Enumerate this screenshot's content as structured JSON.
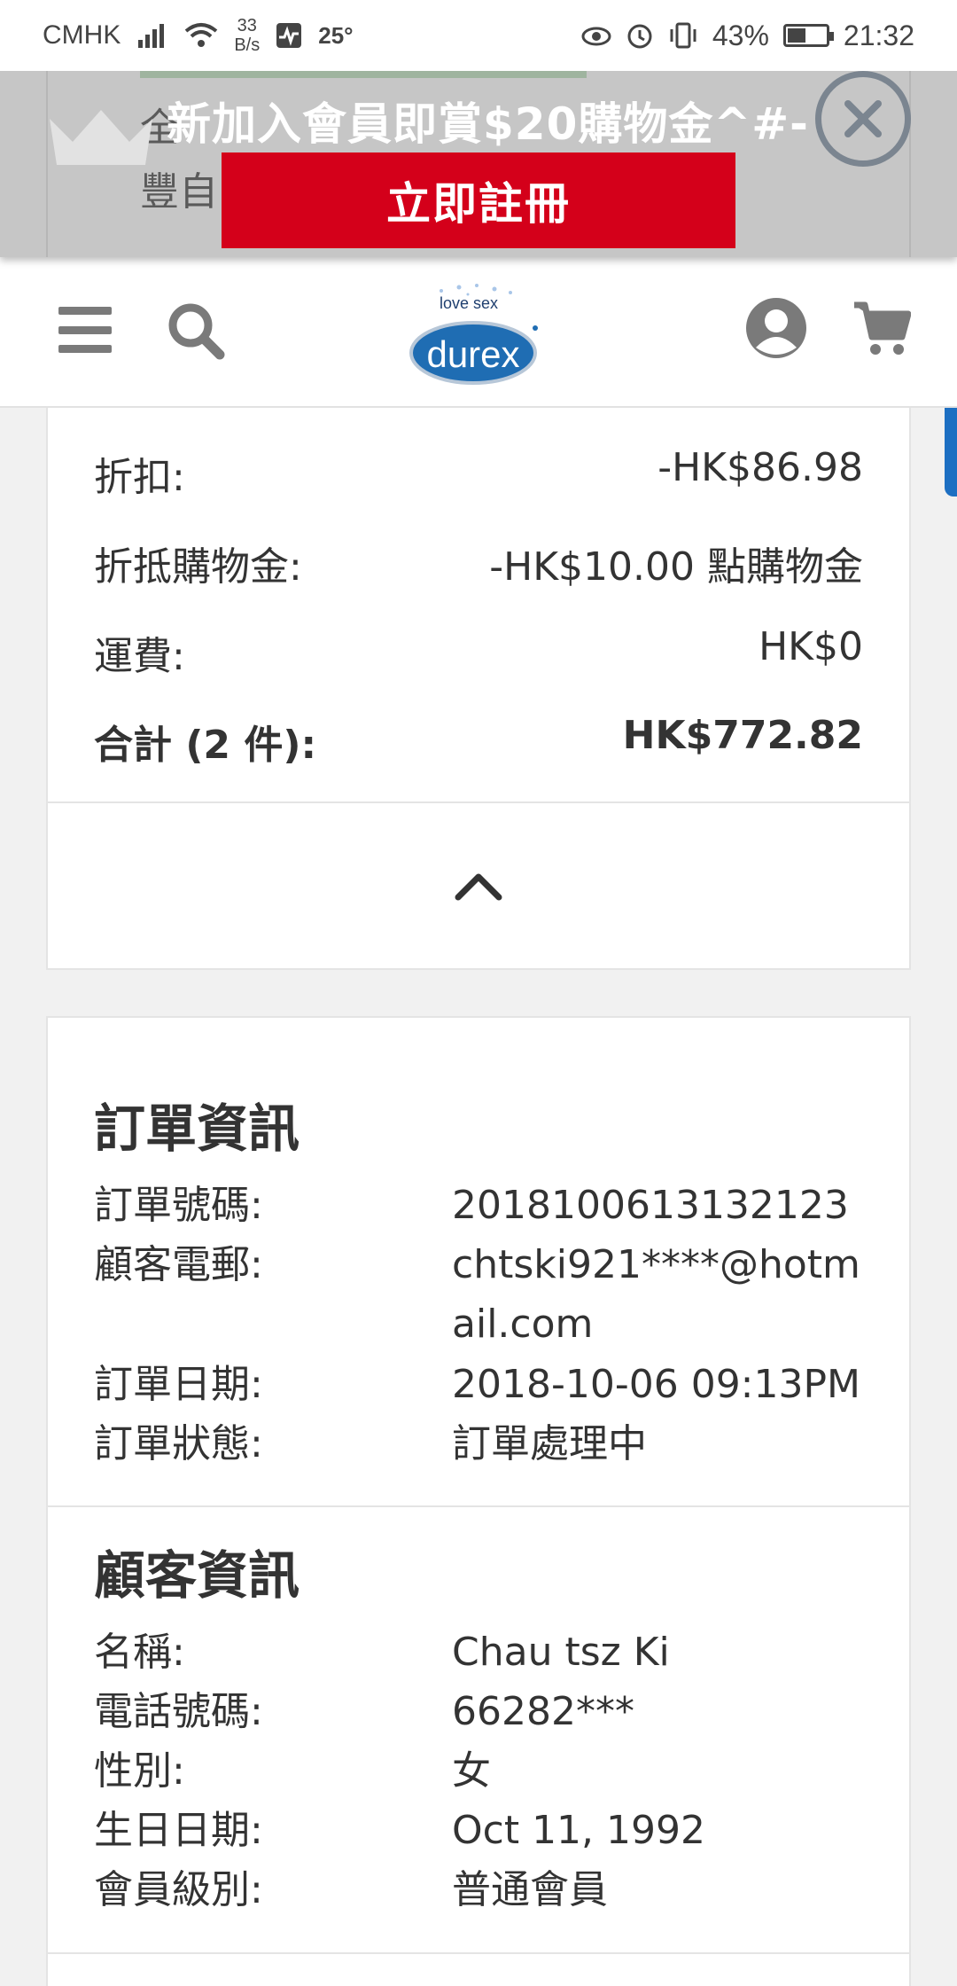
{
  "status_bar": {
    "carrier": "CMHK",
    "speed_value": "33",
    "speed_unit": "B/s",
    "temperature": "25°",
    "battery": "43%",
    "time": "21:32"
  },
  "promo": {
    "title": "新加入會員即賞$20購物金^#-",
    "register_label": "立即註冊",
    "under_text_1": "全",
    "under_text_2": "豐自",
    "close_icon": "close-circle-icon"
  },
  "header": {
    "logo_tagline": "love sex",
    "logo_text": "durex",
    "icons": [
      "menu-icon",
      "search-icon",
      "user-icon",
      "cart-icon"
    ]
  },
  "summary": {
    "rows": [
      {
        "label": "折扣:",
        "value": "-HK$86.98"
      },
      {
        "label": "折抵購物金:",
        "value": "-HK$10.00 點購物金"
      },
      {
        "label": "運費:",
        "value": "HK$0"
      },
      {
        "label": "合計 (2 件):",
        "value": "HK$772.82"
      }
    ]
  },
  "order_info": {
    "title": "訂單資訊",
    "fields": [
      {
        "label": "訂單號碼:",
        "value": "2018100613132123"
      },
      {
        "label": "顧客電郵:",
        "value": "chtski921****@hotmail.com"
      },
      {
        "label": "訂單日期:",
        "value": "2018-10-06 09:13PM"
      },
      {
        "label": "訂單狀態:",
        "value": "訂單處理中"
      }
    ]
  },
  "customer_info": {
    "title": "顧客資訊",
    "fields": [
      {
        "label": "名稱:",
        "value": "Chau tsz Ki"
      },
      {
        "label": "電話號碼:",
        "value": "66282***"
      },
      {
        "label": "性別:",
        "value": "女"
      },
      {
        "label": "生日日期:",
        "value": "Oct 11, 1992"
      },
      {
        "label": "會員級別:",
        "value": "普通會員"
      }
    ]
  },
  "colors": {
    "accent_red": "#d4001a",
    "logo_blue": "#1f6db3",
    "side_tab_blue": "#1d6fc2"
  }
}
